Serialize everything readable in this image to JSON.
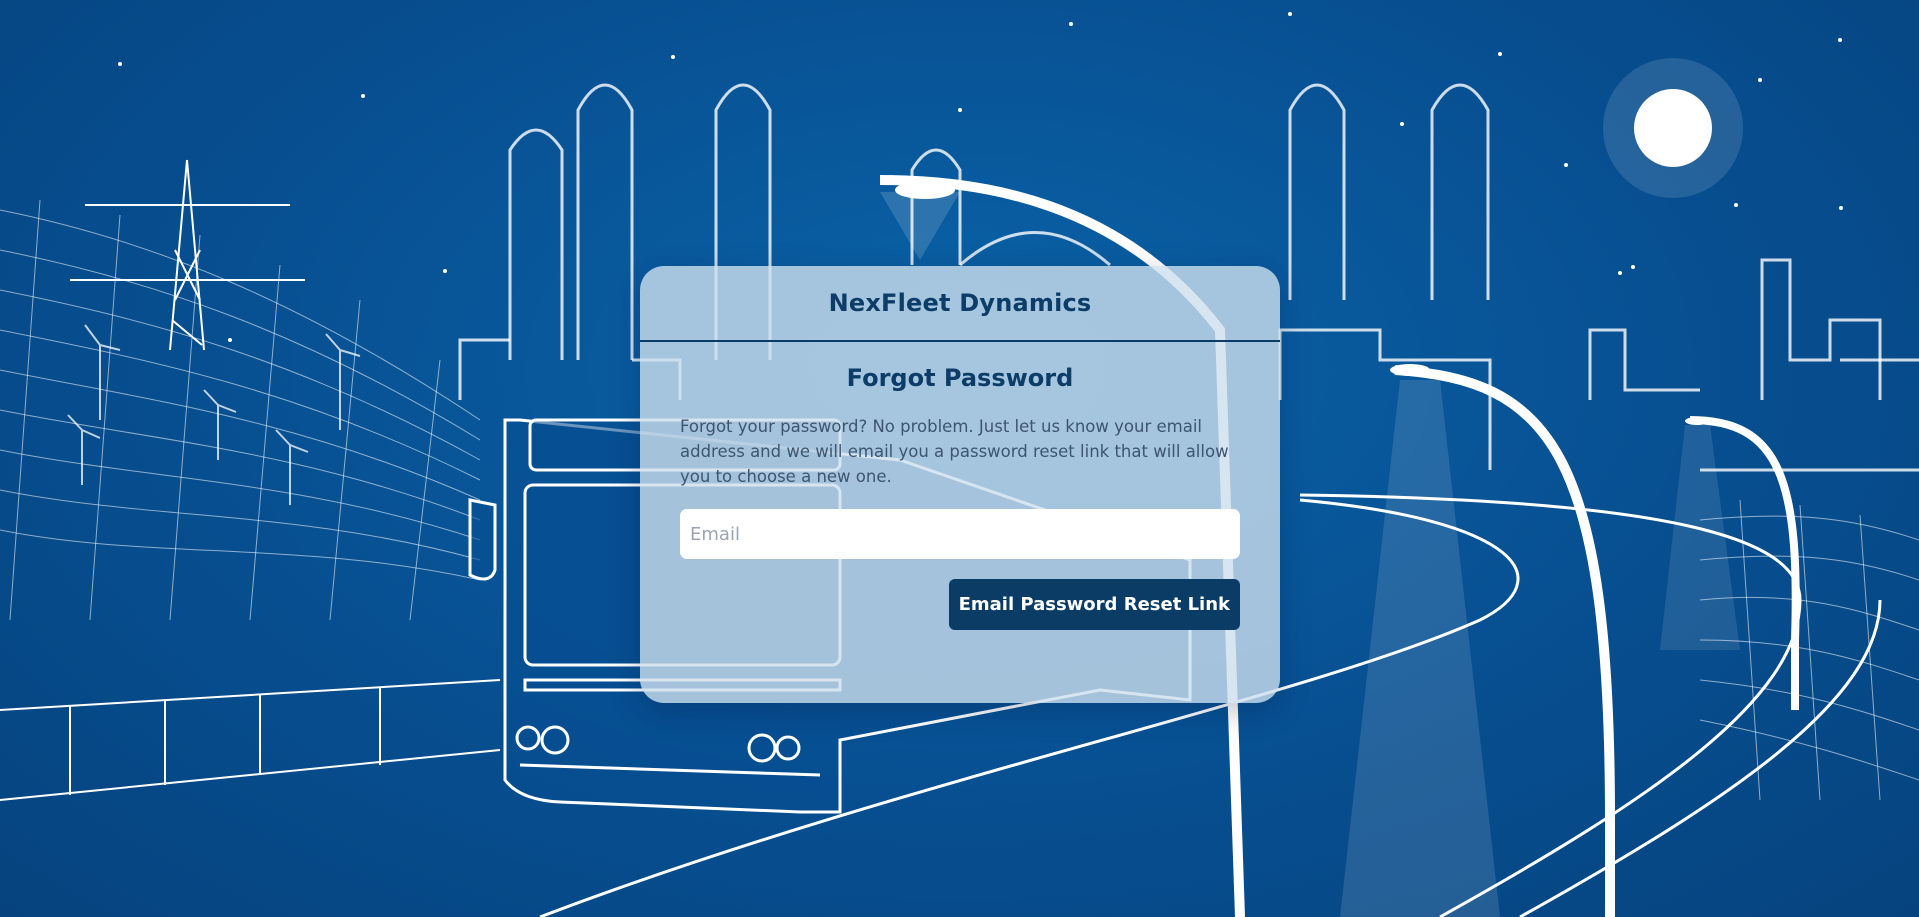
{
  "app": {
    "brand": "NexFleet Dynamics"
  },
  "form": {
    "title": "Forgot Password",
    "info": "Forgot your password? No problem. Just let us know your email address and we will email you a password reset link that will allow you to choose a new one.",
    "email_placeholder": "Email",
    "email_value": "",
    "submit_label": "Email Password Reset Link"
  },
  "colors": {
    "background": "#074f91",
    "card": "#cddeee",
    "accent": "#0b3c66",
    "line_art": "#ffffff"
  },
  "icons": {
    "background": "city-bus-night-illustration"
  }
}
